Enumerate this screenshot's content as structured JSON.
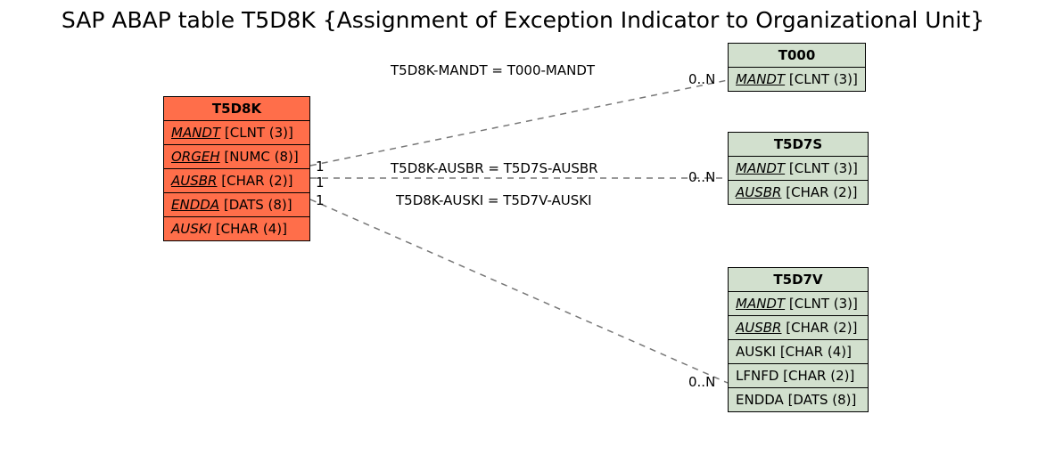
{
  "title": "SAP ABAP table T5D8K {Assignment of Exception Indicator to Organizational Unit}",
  "entities": {
    "t5d8k": {
      "name": "T5D8K",
      "fields": [
        {
          "name": "MANDT",
          "type": "[CLNT (3)]",
          "key": true
        },
        {
          "name": "ORGEH",
          "type": "[NUMC (8)]",
          "key": true
        },
        {
          "name": "AUSBR",
          "type": "[CHAR (2)]",
          "key": true
        },
        {
          "name": "ENDDA",
          "type": "[DATS (8)]",
          "key": true
        },
        {
          "name": "AUSKI",
          "type": "[CHAR (4)]",
          "key": false,
          "italic": true
        }
      ]
    },
    "t000": {
      "name": "T000",
      "fields": [
        {
          "name": "MANDT",
          "type": "[CLNT (3)]",
          "key": true
        }
      ]
    },
    "t5d7s": {
      "name": "T5D7S",
      "fields": [
        {
          "name": "MANDT",
          "type": "[CLNT (3)]",
          "key": true
        },
        {
          "name": "AUSBR",
          "type": "[CHAR (2)]",
          "key": true
        }
      ]
    },
    "t5d7v": {
      "name": "T5D7V",
      "fields": [
        {
          "name": "MANDT",
          "type": "[CLNT (3)]",
          "key": true
        },
        {
          "name": "AUSBR",
          "type": "[CHAR (2)]",
          "key": true
        },
        {
          "name": "AUSKI",
          "type": "[CHAR (4)]",
          "key": false
        },
        {
          "name": "LFNFD",
          "type": "[CHAR (2)]",
          "key": false
        },
        {
          "name": "ENDDA",
          "type": "[DATS (8)]",
          "key": false
        }
      ]
    }
  },
  "relations": {
    "r1": {
      "label": "T5D8K-MANDT = T000-MANDT",
      "left_card": "",
      "right_card": "0..N"
    },
    "r2": {
      "label": "T5D8K-AUSBR = T5D7S-AUSBR",
      "left_card": "1",
      "right_card": "0..N"
    },
    "r3": {
      "label": "T5D8K-AUSKI = T5D7V-AUSKI",
      "left_card": "1",
      "right_card": "0..N"
    },
    "extra_left_card": "1"
  }
}
